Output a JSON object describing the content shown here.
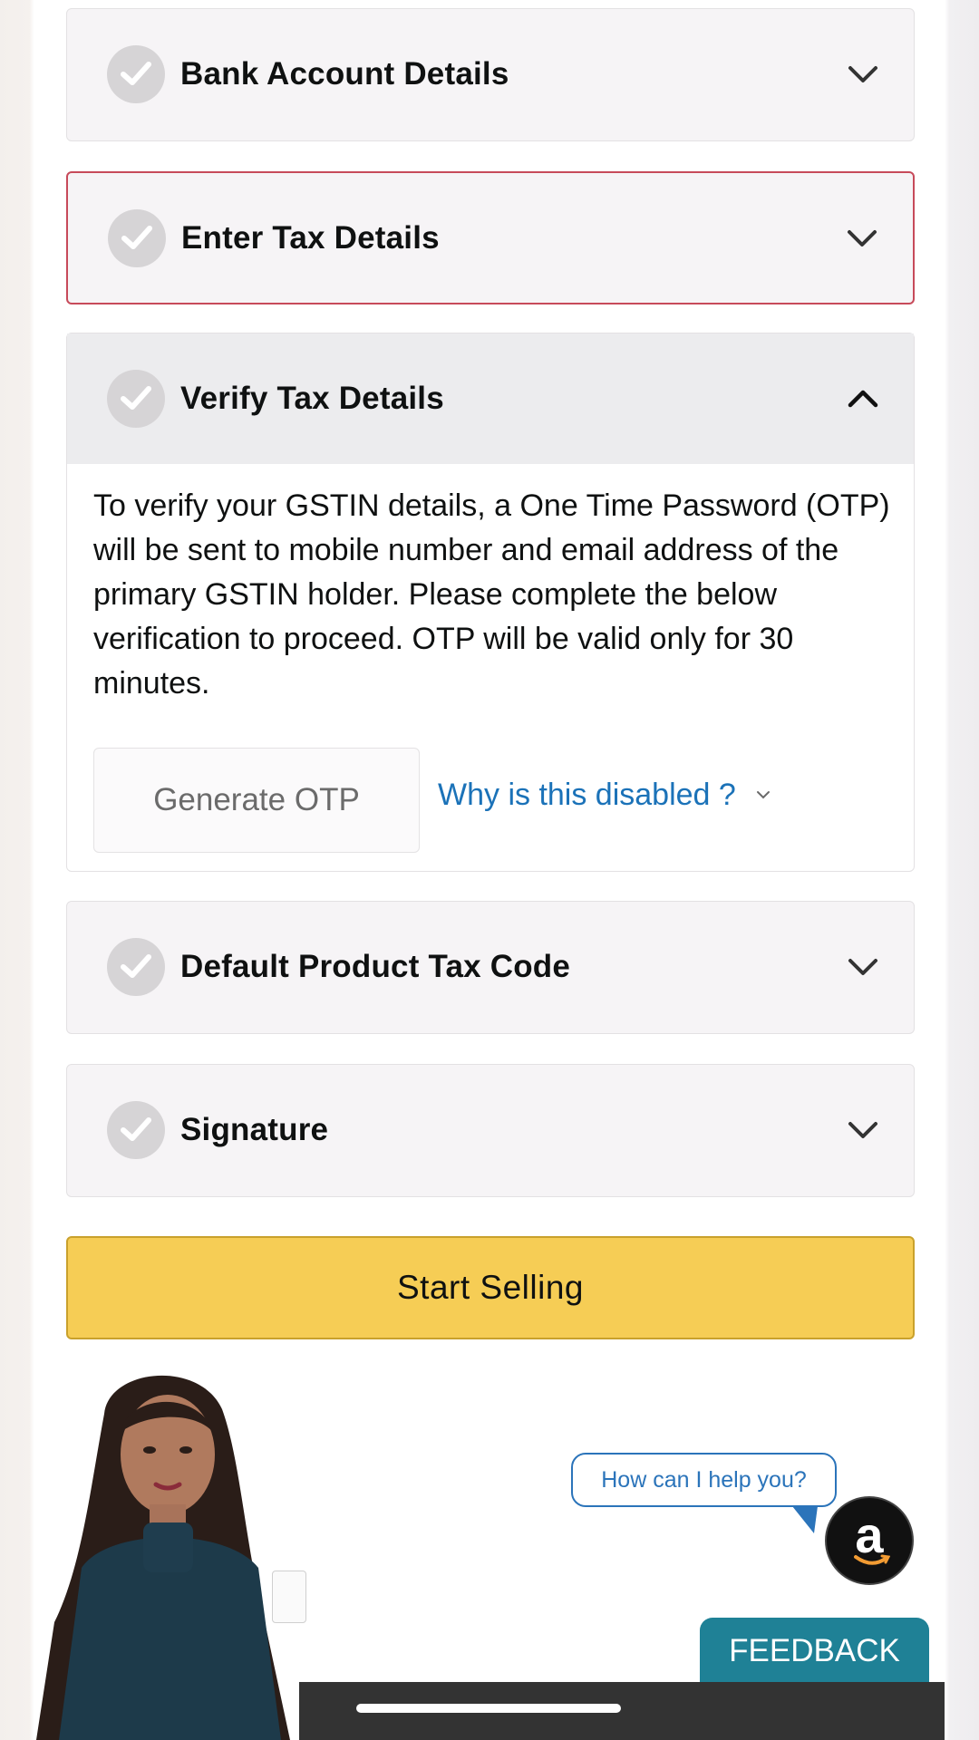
{
  "sections": {
    "bank": {
      "title": "Bank Account Details"
    },
    "enter_tax": {
      "title": "Enter Tax Details"
    },
    "verify_tax": {
      "title": "Verify Tax Details",
      "body": "To verify your GSTIN details, a One Time Password (OTP) will be sent to mobile number and email address of the primary GSTIN holder. Please complete the below verification to proceed. OTP will be valid only for 30 minutes.",
      "generate_otp_label": "Generate OTP",
      "why_disabled_label": "Why is this disabled ?"
    },
    "product_tax_code": {
      "title": "Default Product Tax Code"
    },
    "signature": {
      "title": "Signature"
    }
  },
  "start_selling_label": "Start Selling",
  "chat": {
    "prompt": "How can I help you?",
    "logo_letter": "a"
  },
  "feedback_label": "FEEDBACK",
  "colors": {
    "accent_yellow": "#f6cd55",
    "link_blue": "#1b72b8",
    "error_border": "#c74a5a",
    "feedback_teal": "#1f8196"
  }
}
